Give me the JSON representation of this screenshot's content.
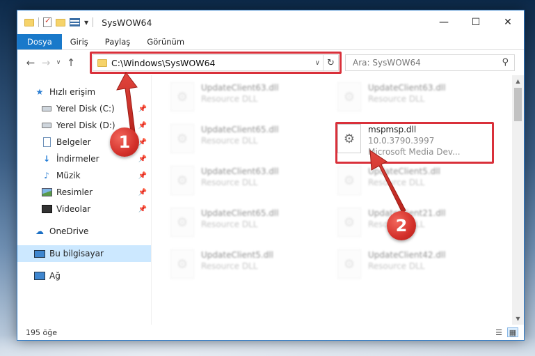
{
  "window": {
    "title": "SysWOW64",
    "controls": {
      "minimize": "—",
      "maximize": "☐",
      "close": "✕"
    }
  },
  "ribbon": {
    "tabs": [
      "Dosya",
      "Giriş",
      "Paylaş",
      "Görünüm"
    ]
  },
  "address_bar": {
    "path": "C:\\Windows\\SysWOW64"
  },
  "search": {
    "placeholder": "Ara: SysWOW64"
  },
  "nav_pane": {
    "items": [
      {
        "label": "Hızlı erişim",
        "icon": "star-icon",
        "pinned": false
      },
      {
        "label": "Yerel Disk (C:)",
        "icon": "drive-icon",
        "pinned": true
      },
      {
        "label": "Yerel Disk (D:)",
        "icon": "drive-icon",
        "pinned": true
      },
      {
        "label": "Belgeler",
        "icon": "documents-icon",
        "pinned": true
      },
      {
        "label": "İndirmeler",
        "icon": "downloads-icon",
        "pinned": true
      },
      {
        "label": "Müzik",
        "icon": "music-icon",
        "pinned": true
      },
      {
        "label": "Resimler",
        "icon": "pictures-icon",
        "pinned": true
      },
      {
        "label": "Videolar",
        "icon": "videos-icon",
        "pinned": true
      },
      {
        "label": "OneDrive",
        "icon": "onedrive-icon",
        "pinned": false
      },
      {
        "label": "Bu bilgisayar",
        "icon": "this-pc-icon",
        "pinned": false,
        "selected": true
      },
      {
        "label": "Ağ",
        "icon": "network-icon",
        "pinned": false
      }
    ]
  },
  "files": [
    {
      "name": "UpdateClient63.dll",
      "line1": "Resource DLL",
      "line2": "",
      "blurred": true
    },
    {
      "name": "UpdateClient63.dll",
      "line1": "Resource DLL",
      "line2": "",
      "blurred": true
    },
    {
      "name": "UpdateClient65.dll",
      "line1": "Resource DLL",
      "line2": "",
      "blurred": true
    },
    {
      "name": "mspmsp.dll",
      "line1": "10.0.3790.3997",
      "line2": "Microsoft Media Dev...",
      "blurred": false
    },
    {
      "name": "UpdateClient63.dll",
      "line1": "Resource DLL",
      "line2": "",
      "blurred": true
    },
    {
      "name": "UpdateClient5.dll",
      "line1": "Resource DLL",
      "line2": "",
      "blurred": true
    },
    {
      "name": "UpdateClient65.dll",
      "line1": "Resource DLL",
      "line2": "",
      "blurred": true
    },
    {
      "name": "UpdateClient21.dll",
      "line1": "Resource DLL",
      "line2": "",
      "blurred": true
    },
    {
      "name": "UpdateClient5.dll",
      "line1": "Resource DLL",
      "line2": "",
      "blurred": true
    },
    {
      "name": "UpdateClient42.dll",
      "line1": "Resource DLL",
      "line2": "",
      "blurred": true
    }
  ],
  "status_bar": {
    "item_count": "195 öğe"
  },
  "annotations": {
    "badge1": "1",
    "badge2": "2",
    "color": "#d9303a"
  }
}
